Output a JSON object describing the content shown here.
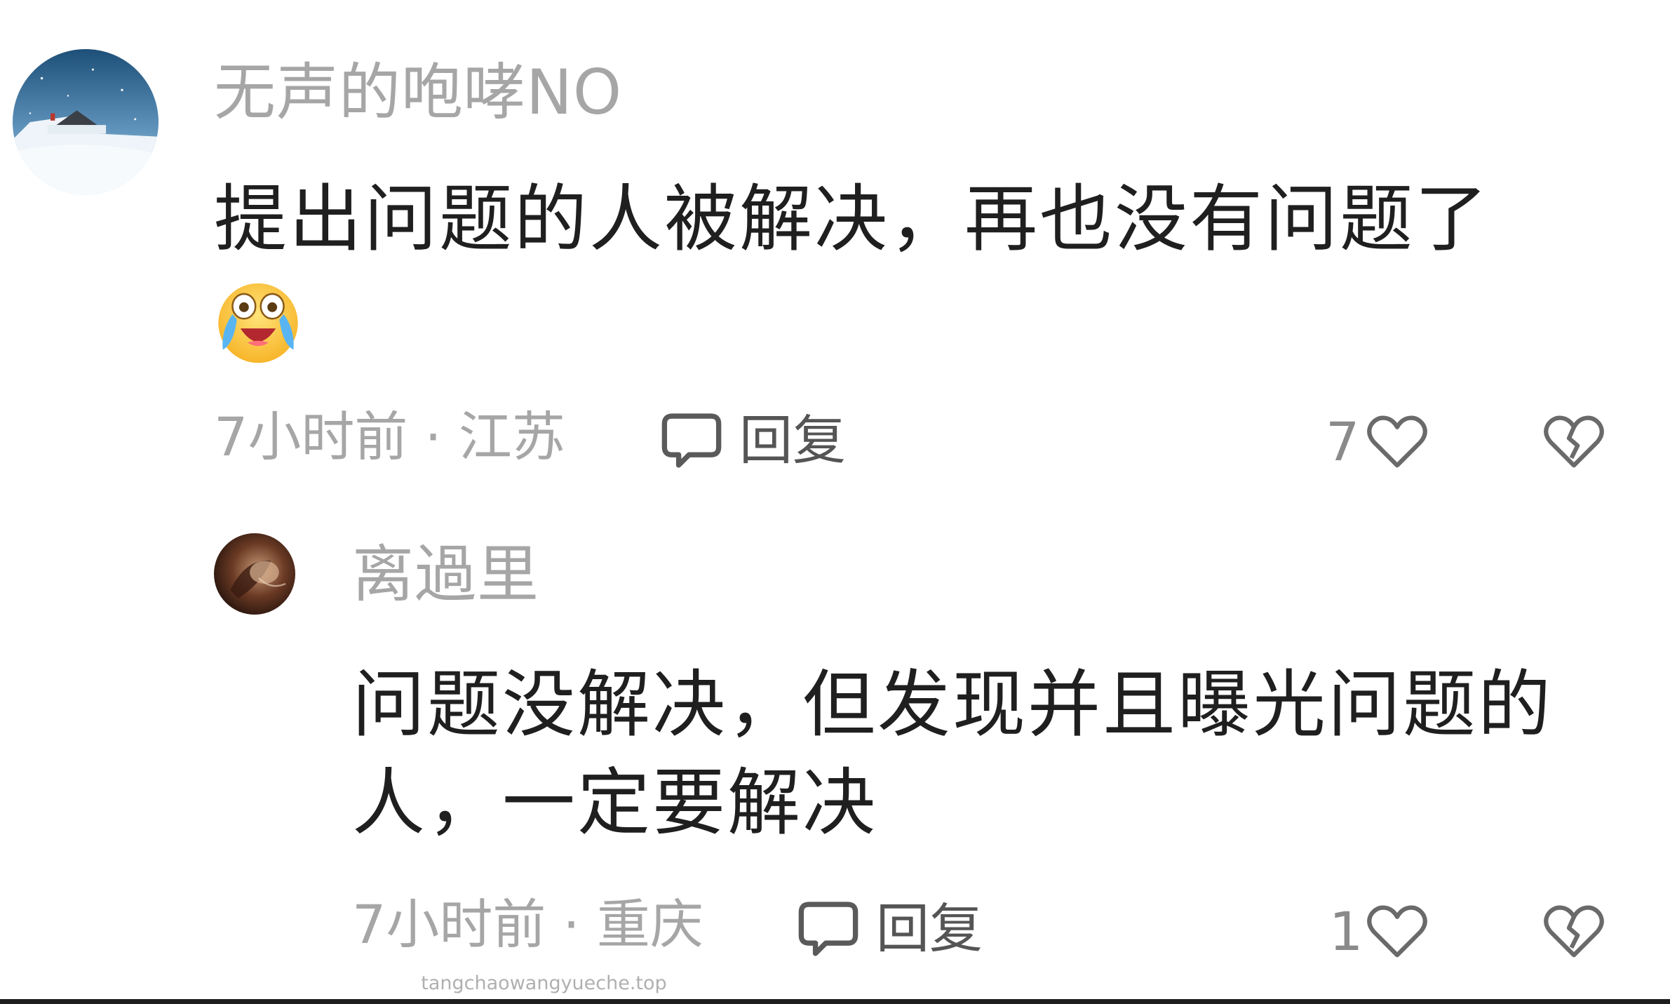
{
  "comments": [
    {
      "username": "无声的咆哮NO",
      "text_line1": "提出问题的人被解决，再也没有问题了",
      "emoji": "crying-laughing-emoji",
      "time_location": "7小时前 · 江苏",
      "reply_label": "回复",
      "likes": "7"
    },
    {
      "username": "离過里",
      "text_line1": "问题没解决，但发现并且曝光问题的",
      "text_line2": "人，一定要解决",
      "time_location": "7小时前 · 重庆",
      "reply_label": "回复",
      "likes": "1"
    }
  ],
  "watermark": "tangchaowangyueche.top",
  "icons": {
    "reply": "speech-bubble-icon",
    "like": "heart-outline-icon",
    "dislike": "broken-heart-icon"
  },
  "colors": {
    "username": "#a6a6a6",
    "text": "#1f1f1f",
    "meta": "#a6a6a6",
    "icon": "#555555"
  }
}
